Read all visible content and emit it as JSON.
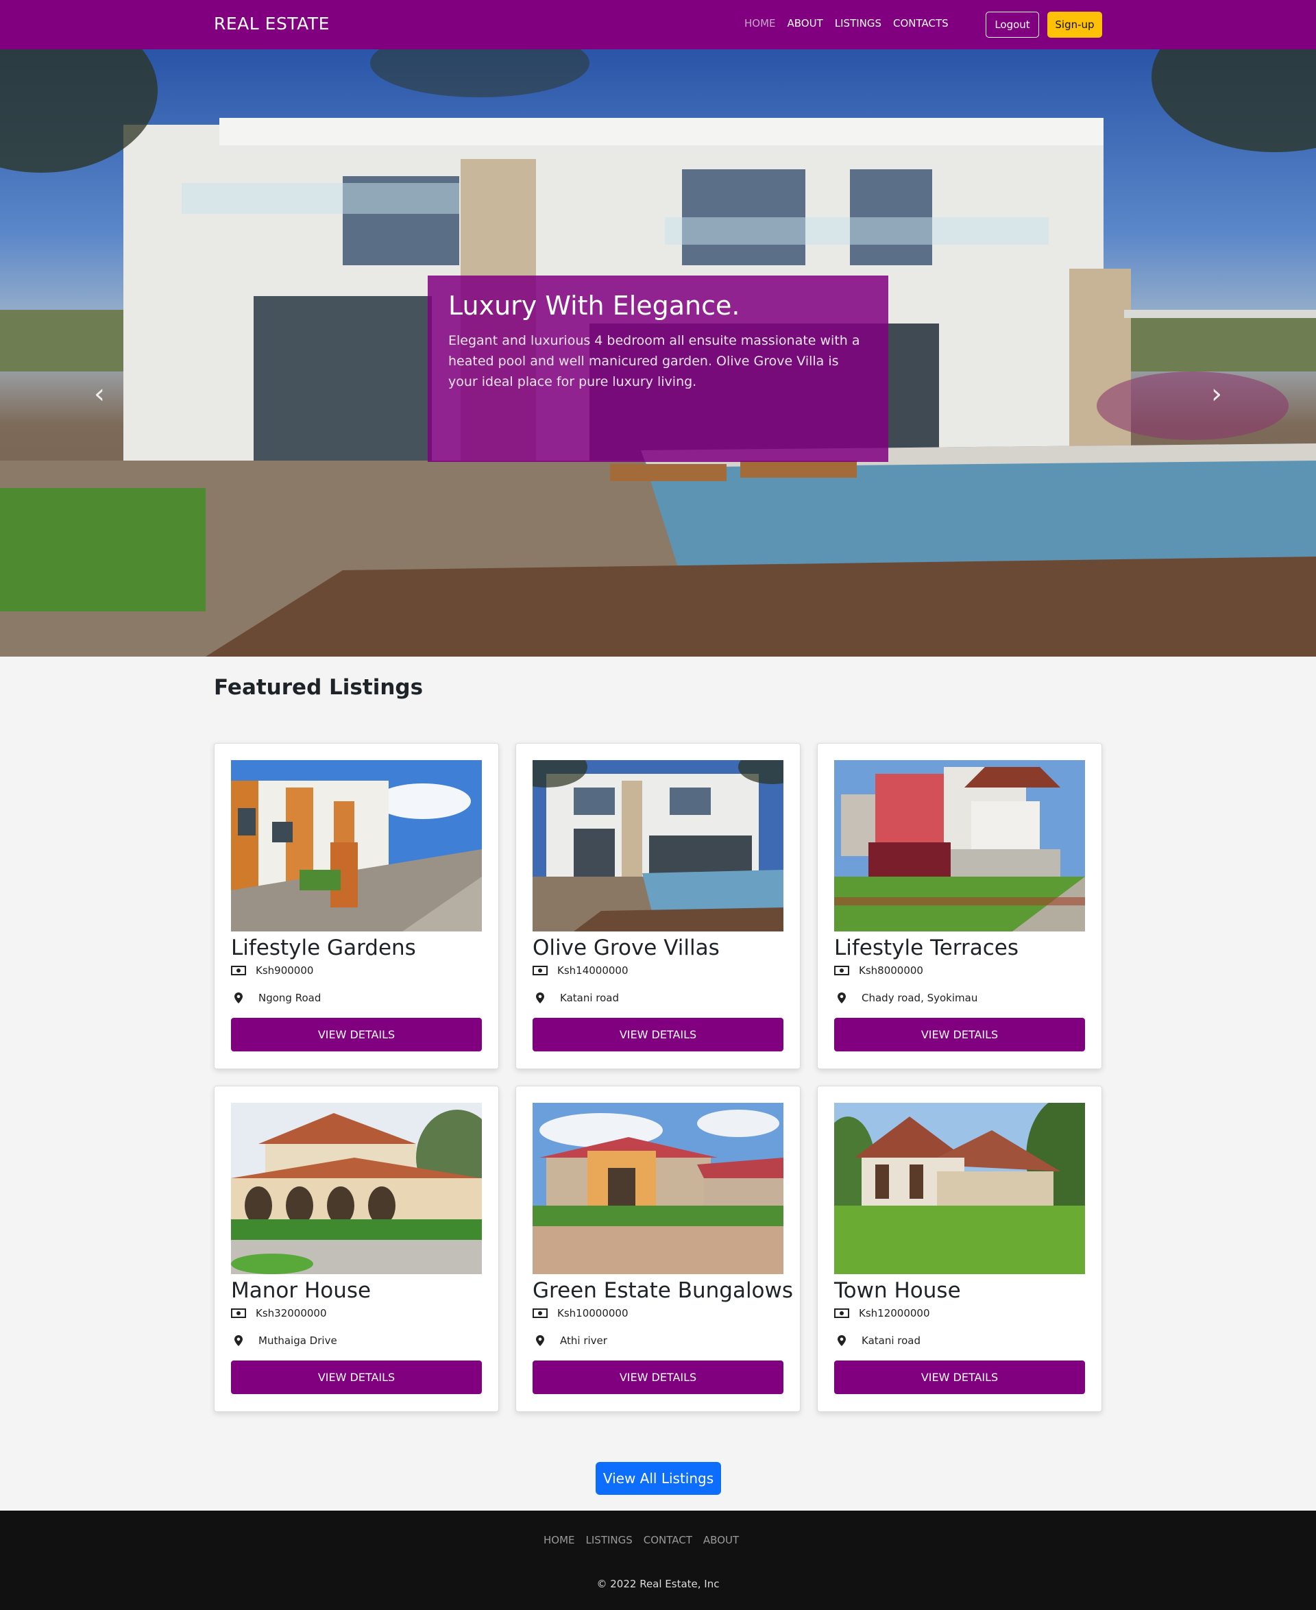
{
  "brand": "REAL ESTATE",
  "nav": {
    "links": [
      "HOME",
      "ABOUT",
      "LISTINGS",
      "CONTACTS"
    ],
    "active": "HOME",
    "logout_label": "Logout",
    "signup_label": "Sign-up"
  },
  "hero": {
    "title": "Luxury With Elegance.",
    "text": "Elegant and luxurious 4 bedroom all ensuite massionate with a heated pool and well manicured garden. Olive Grove Villa is your ideal place for pure luxury living.",
    "prev_icon": "chevron-left-icon",
    "next_icon": "chevron-right-icon",
    "slide_count": 3,
    "active_slide": 1
  },
  "featured": {
    "title": "Featured Listings",
    "button_label": "VIEW DETAILS",
    "listings": [
      {
        "name": "Lifestyle Gardens",
        "price": "Ksh900000",
        "location": "Ngong Road"
      },
      {
        "name": "Olive Grove Villas",
        "price": "Ksh14000000",
        "location": "Katani road"
      },
      {
        "name": "Lifestyle Terraces",
        "price": "Ksh8000000",
        "location": "Chady road, Syokimau"
      },
      {
        "name": "Manor House",
        "price": "Ksh32000000",
        "location": "Muthaiga Drive"
      },
      {
        "name": "Green Estate Bungalows",
        "price": "Ksh10000000",
        "location": "Athi river"
      },
      {
        "name": "Town House",
        "price": "Ksh12000000",
        "location": "Katani road"
      }
    ],
    "view_all_label": "View All Listings"
  },
  "footer": {
    "links": [
      "HOME",
      "LISTINGS",
      "CONTACT",
      "ABOUT"
    ],
    "copyright": "© 2022 Real Estate, Inc"
  },
  "colors": {
    "brand_purple": "#800080",
    "signup_yellow": "#ffc107",
    "view_all_blue": "#0d6efd",
    "footer_bg": "#111111"
  }
}
